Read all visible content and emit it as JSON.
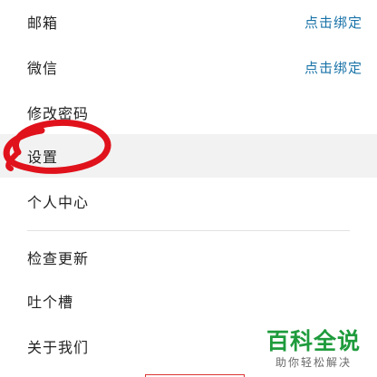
{
  "menu": {
    "email": {
      "label": "邮箱",
      "action": "点击绑定"
    },
    "wechat": {
      "label": "微信",
      "action": "点击绑定"
    },
    "change_password": {
      "label": "修改密码"
    },
    "settings": {
      "label": "设置"
    },
    "personal_center": {
      "label": "个人中心"
    },
    "check_update": {
      "label": "检查更新"
    },
    "feedback": {
      "label": "吐个槽"
    },
    "about": {
      "label": "关于我们"
    }
  },
  "annotation": {
    "color": "#e0121c",
    "shape": "hand-drawn circle around Settings"
  },
  "watermark": {
    "title": "百科全说",
    "subtitle": "助你轻松解决"
  },
  "colors": {
    "action_link": "#1a73a8",
    "highlight_row": "#f2f2f2",
    "watermark_green": "#1e9b3c"
  }
}
